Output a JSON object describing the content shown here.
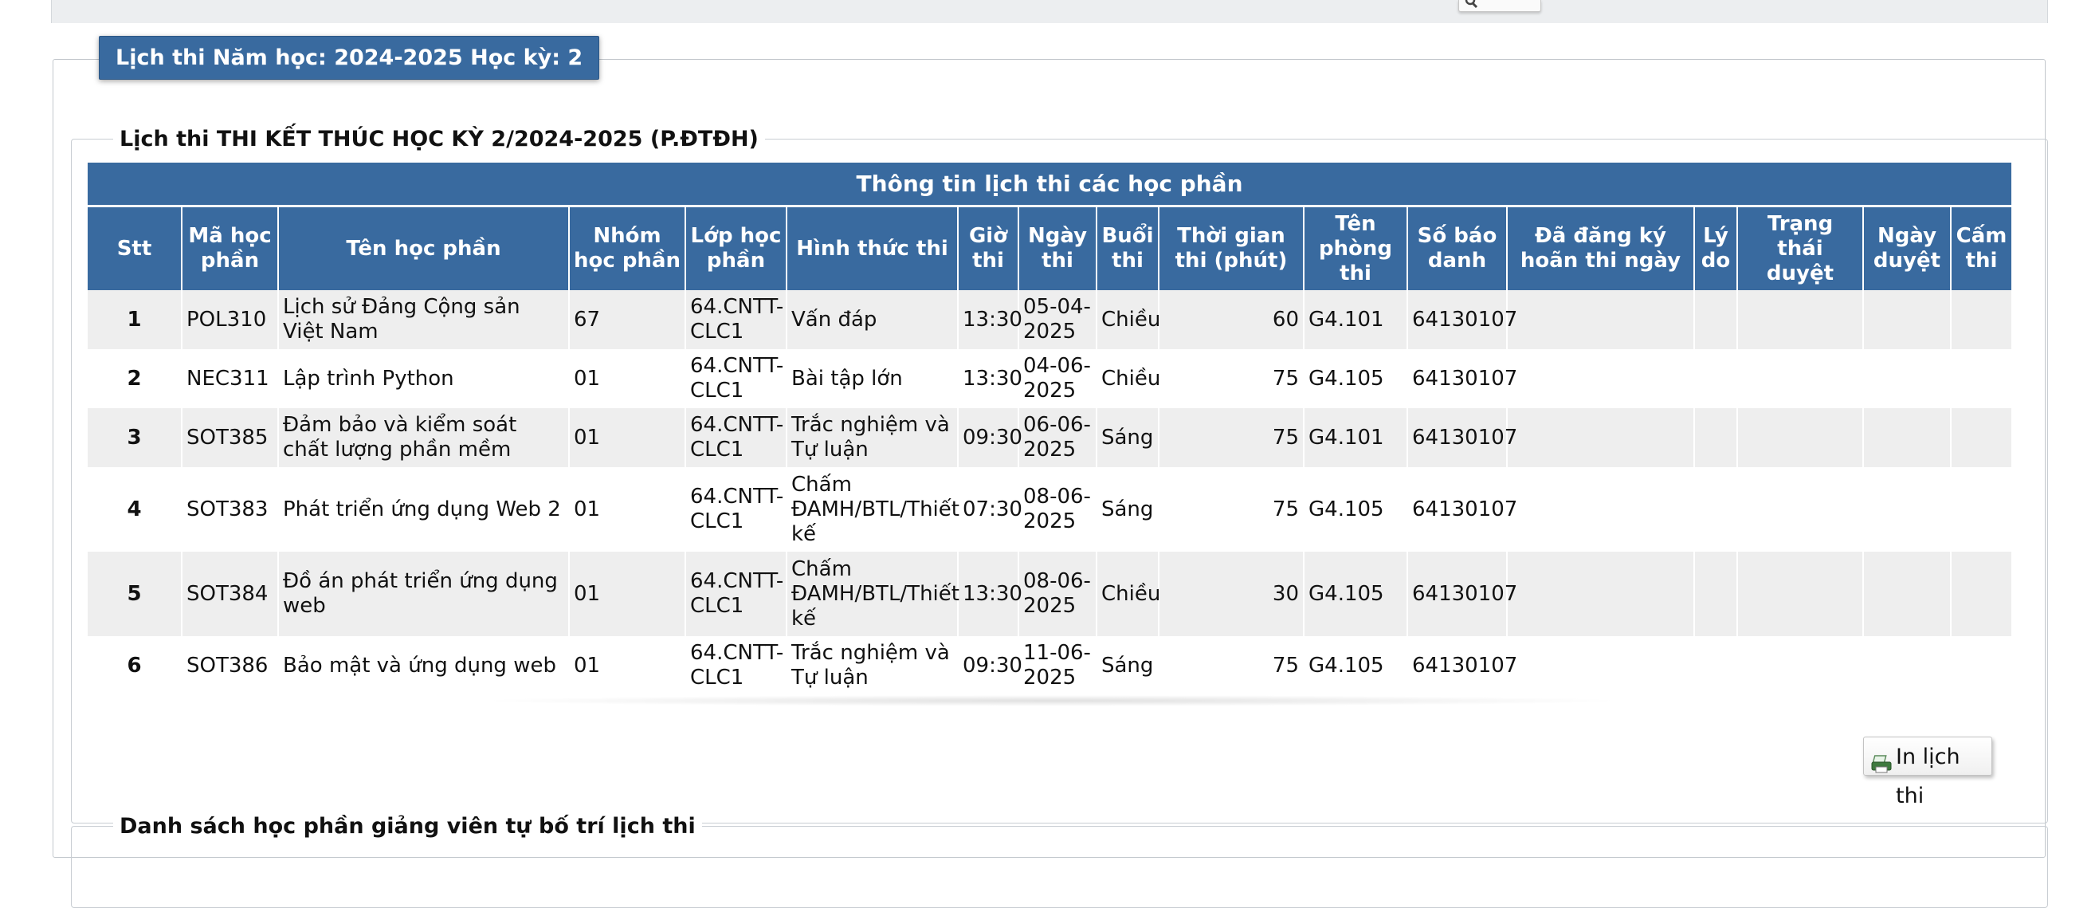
{
  "tab_title": "Lịch thi Năm học: 2024-2025 Học kỳ: 2",
  "schedule_group_title": "Lịch thi THI KẾT THÚC HỌC KỲ 2/2024-2025 (P.ĐTĐH)",
  "table": {
    "banner": "Thông tin lịch thi các học phần",
    "headers": [
      "Stt",
      "Mã học phần",
      "Tên học phần",
      "Nhóm học phần",
      "Lớp học phần",
      "Hình thức thi",
      "Giờ thi",
      "Ngày thi",
      "Buổi thi",
      "Thời gian thi (phút)",
      "Tên phòng thi",
      "Số báo danh",
      "Đã đăng ký hoãn thi ngày",
      "Lý do",
      "Trạng thái duyệt",
      "Ngày duyệt",
      "Cấm thi"
    ],
    "rows": [
      [
        "1",
        "POL310",
        "Lịch sử Đảng Cộng sản Việt Nam",
        "67",
        "64.CNTT-CLC1",
        "Vấn đáp",
        "13:30",
        "05-04-2025",
        "Chiều",
        "60",
        "G4.101",
        "64130107",
        "",
        "",
        "",
        "",
        ""
      ],
      [
        "2",
        "NEC311",
        "Lập trình Python",
        "01",
        "64.CNTT-CLC1",
        "Bài tập lớn",
        "13:30",
        "04-06-2025",
        "Chiều",
        "75",
        "G4.105",
        "64130107",
        "",
        "",
        "",
        "",
        ""
      ],
      [
        "3",
        "SOT385",
        "Đảm bảo và kiểm soát chất lượng phần mềm",
        "01",
        "64.CNTT-CLC1",
        "Trắc nghiệm và Tự luận",
        "09:30",
        "06-06-2025",
        "Sáng",
        "75",
        "G4.101",
        "64130107",
        "",
        "",
        "",
        "",
        ""
      ],
      [
        "4",
        "SOT383",
        "Phát triển ứng dụng Web 2",
        "01",
        "64.CNTT-CLC1",
        "Chấm ĐAMH/BTL/Thiết kế",
        "07:30",
        "08-06-2025",
        "Sáng",
        "75",
        "G4.105",
        "64130107",
        "",
        "",
        "",
        "",
        ""
      ],
      [
        "5",
        "SOT384",
        "Đồ án phát triển ứng dụng web",
        "01",
        "64.CNTT-CLC1",
        "Chấm ĐAMH/BTL/Thiết kế",
        "13:30",
        "08-06-2025",
        "Chiều",
        "30",
        "G4.105",
        "64130107",
        "",
        "",
        "",
        "",
        ""
      ],
      [
        "6",
        "SOT386",
        "Bảo mật và ứng dụng web",
        "01",
        "64.CNTT-CLC1",
        "Trắc nghiệm và Tự luận",
        "09:30",
        "11-06-2025",
        "Sáng",
        "75",
        "G4.105",
        "64130107",
        "",
        "",
        "",
        "",
        ""
      ]
    ]
  },
  "print_button_label": "In lịch thi",
  "list_group_title": "Danh sách học phần giảng viên tự bố trí lịch thi",
  "icons": {
    "search": "magnifier-icon",
    "print": "printer-icon"
  },
  "colors": {
    "header_blue": "#396a9f",
    "row_alt": "#eeeeee"
  }
}
